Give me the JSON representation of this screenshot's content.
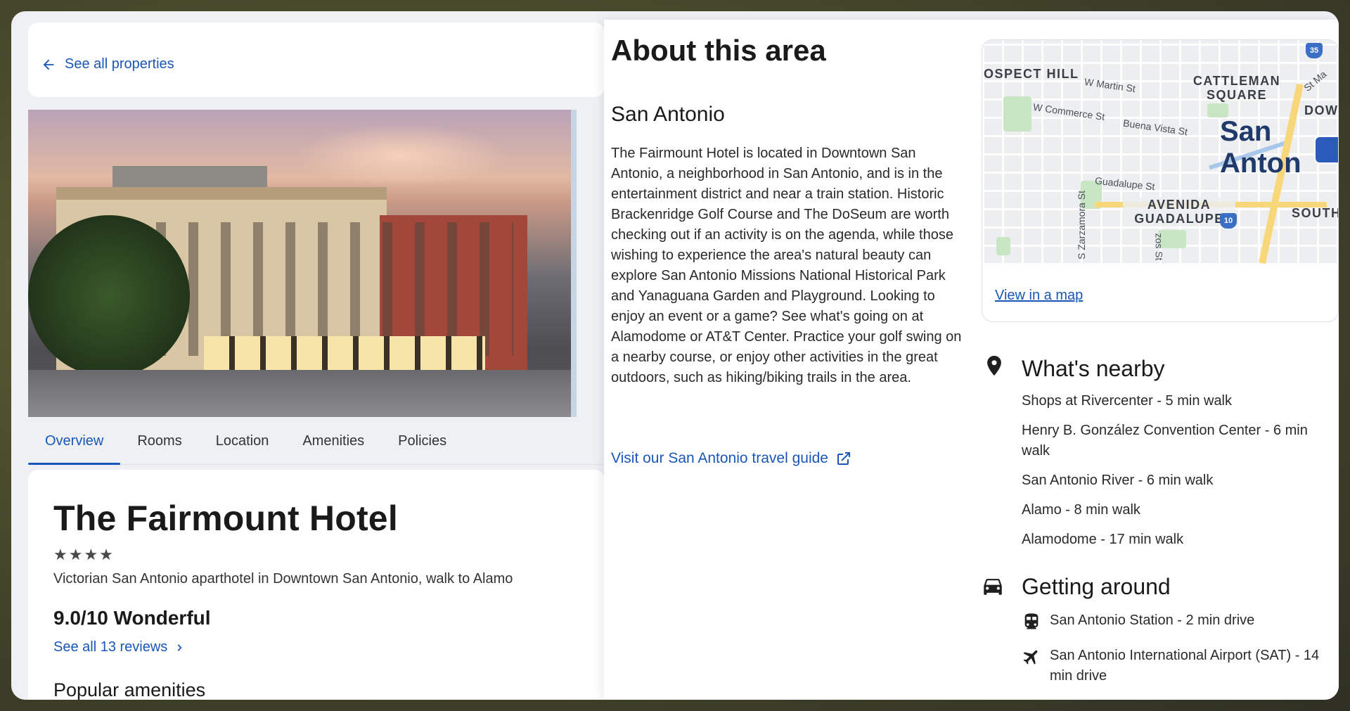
{
  "left": {
    "back_label": "See all properties",
    "tabs": [
      {
        "label": "Overview",
        "active": true
      },
      {
        "label": "Rooms"
      },
      {
        "label": "Location"
      },
      {
        "label": "Amenities"
      },
      {
        "label": "Policies"
      }
    ],
    "hotel_name": "The Fairmount Hotel",
    "stars": "★★★★",
    "star_rating": 4,
    "tagline": "Victorian San Antonio aparthotel in Downtown San Antonio, walk to Alamo",
    "rating": "9.0/10 Wonderful",
    "reviews_link": "See all 13 reviews",
    "popular_amenities": "Popular amenities"
  },
  "right": {
    "title": "About this area",
    "city": "San Antonio",
    "description": "The Fairmount Hotel is located in Downtown San Antonio, a neighborhood in San Antonio, and is in the entertainment district and near a train station. Historic Brackenridge Golf Course and The DoSeum are worth checking out if an activity is on the agenda, while those wishing to experience the area's natural beauty can explore San Antonio Missions National Historical Park and Yanaguana Garden and Playground. Looking to enjoy an event or a game? See what's going on at Alamodome or AT&T Center. Practice your golf swing on a nearby course, or enjoy other activities in the great outdoors, such as hiking/biking trails in the area.",
    "guide_link": "Visit our San Antonio travel guide",
    "map": {
      "labels": {
        "prospect_hill": "OSPECT HILL",
        "cattleman": "CATTLEMAN\nSQUARE",
        "downtown": "DOWN",
        "avenida": "AVENIDA\nGUADALUPE",
        "south": "SOUTHT",
        "city": "San Anton"
      },
      "streets": {
        "w_martin": "W Martin St",
        "w_commerce": "W Commerce St",
        "buena_vista": "Buena Vista St",
        "guadalupe": "Guadalupe St",
        "s_zarzamora": "S Zarzamora St",
        "st_ma": "St Ma",
        "nzos": "zos St"
      },
      "shields": {
        "i35": "35",
        "i10": "10"
      },
      "link": "View in a map"
    },
    "nearby": {
      "title": "What's nearby",
      "items": [
        "Shops at Rivercenter - 5 min walk",
        "Henry B. González Convention Center - 6 min walk",
        "San Antonio River - 6 min walk",
        "Alamo - 8 min walk",
        "Alamodome - 17 min walk"
      ]
    },
    "getting_around": {
      "title": "Getting around",
      "items": [
        {
          "icon": "train-icon",
          "text": "San Antonio Station - 2 min drive"
        },
        {
          "icon": "airplane-icon",
          "text": "San Antonio International Airport (SAT) - 14 min drive"
        }
      ]
    }
  },
  "colors": {
    "link": "#1a56b8",
    "text": "#1a1a1a",
    "map_pin": "#2b5bb8"
  }
}
